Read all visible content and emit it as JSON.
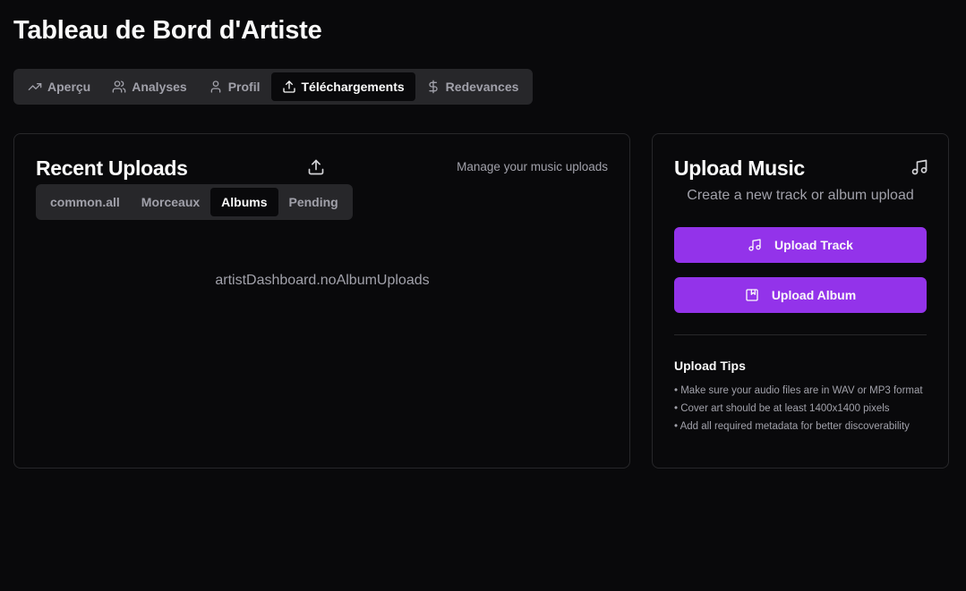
{
  "page": {
    "title": "Tableau de Bord d'Artiste"
  },
  "main_tabs": [
    {
      "label": "Aperçu",
      "icon": "trending-up-icon",
      "active": false
    },
    {
      "label": "Analyses",
      "icon": "users-icon",
      "active": false
    },
    {
      "label": "Profil",
      "icon": "user-icon",
      "active": false
    },
    {
      "label": "Téléchargements",
      "icon": "upload-icon",
      "active": true
    },
    {
      "label": "Redevances",
      "icon": "dollar-icon",
      "active": false
    }
  ],
  "uploads_card": {
    "title": "Recent Uploads",
    "icon": "upload-icon",
    "description": "Manage your music uploads",
    "tabs": [
      {
        "label": "common.all",
        "active": false
      },
      {
        "label": "Morceaux",
        "active": false
      },
      {
        "label": "Albums",
        "active": true
      },
      {
        "label": "Pending",
        "active": false
      }
    ],
    "empty_message": "artistDashboard.noAlbumUploads"
  },
  "upload_card": {
    "title": "Upload Music",
    "icon": "music-note-icon",
    "subtitle": "Create a new track or album upload",
    "upload_track_label": "Upload Track",
    "upload_album_label": "Upload Album",
    "tips_title": "Upload Tips",
    "tips": [
      "• Make sure your audio files are in WAV or MP3 format",
      "• Cover art should be at least 1400x1400 pixels",
      "• Add all required metadata for better discoverability"
    ]
  },
  "colors": {
    "background": "#09090b",
    "accent": "#9333ea",
    "muted_surface": "#27272a",
    "muted_text": "#a1a1aa"
  }
}
